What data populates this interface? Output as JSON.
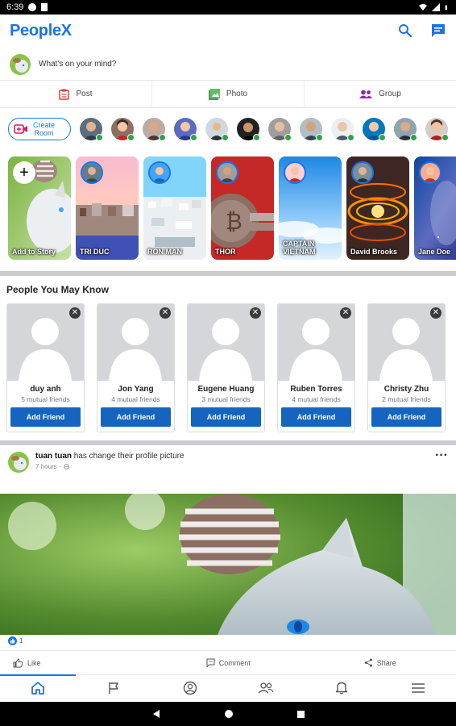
{
  "status_bar": {
    "time": "6:39"
  },
  "app": {
    "title": "PeopleX",
    "accent": "#1a73e8"
  },
  "composer": {
    "prompt": "What's on your mind?"
  },
  "quick_actions": [
    {
      "label": "Post",
      "icon": "post-icon",
      "color": "#e53935"
    },
    {
      "label": "Photo",
      "icon": "photo-icon",
      "color": "#43a047"
    },
    {
      "label": "Group",
      "icon": "group-icon",
      "color": "#8e24aa"
    }
  ],
  "create_room": {
    "label_line1": "Create",
    "label_line2": "Room"
  },
  "online_friends_count": 12,
  "stories": [
    {
      "label": "Add to Story",
      "type": "add"
    },
    {
      "label": "TRI DUC",
      "type": "story"
    },
    {
      "label": "RON MAN",
      "type": "story"
    },
    {
      "label": "THOR",
      "type": "story"
    },
    {
      "label": "CAPTAIN VIETNAM",
      "type": "story"
    },
    {
      "label": "David Brooks",
      "type": "story"
    },
    {
      "label": "Jane Doe",
      "type": "story"
    }
  ],
  "pymk": {
    "title": "People You May Know",
    "add_label": "Add Friend",
    "people": [
      {
        "name": "duy anh",
        "mutual": "5 mutual friends"
      },
      {
        "name": "Jon Yang",
        "mutual": "4 mutual friends"
      },
      {
        "name": "Eugene Huang",
        "mutual": "3 mutual friends"
      },
      {
        "name": "Ruben Torres",
        "mutual": "4 mutual friends"
      },
      {
        "name": "Christy Zhu",
        "mutual": "2 mutual friends"
      }
    ]
  },
  "post": {
    "author": "tuan tuan",
    "action": " has change their profile picture",
    "time": "7 hours",
    "separator": "·",
    "likes": "1"
  },
  "reactions": {
    "like": "Like",
    "comment": "Comment",
    "share": "Share"
  },
  "tabs": [
    {
      "icon": "home-icon",
      "active": true
    },
    {
      "icon": "flag-icon",
      "active": false
    },
    {
      "icon": "profile-icon",
      "active": false
    },
    {
      "icon": "friends-icon",
      "active": false
    },
    {
      "icon": "bell-icon",
      "active": false
    },
    {
      "icon": "menu-icon",
      "active": false
    }
  ]
}
